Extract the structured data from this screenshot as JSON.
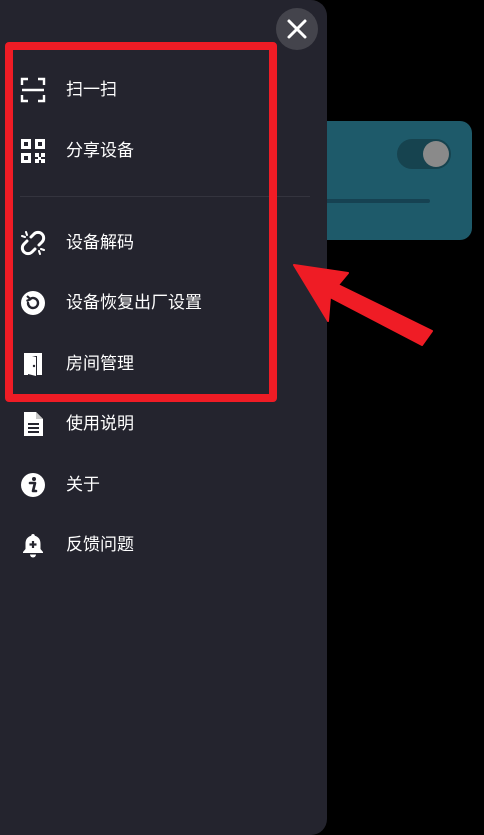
{
  "close_button": {
    "icon": "close-icon"
  },
  "menu": {
    "items": [
      {
        "id": "scan",
        "label": "扫一扫",
        "icon": "scan-frame-icon"
      },
      {
        "id": "share",
        "label": "分享设备",
        "icon": "qr-code-icon"
      },
      {
        "id": "unbind",
        "label": "设备解码",
        "icon": "broken-link-icon"
      },
      {
        "id": "reset",
        "label": "设备恢复出厂设置",
        "icon": "reset-circle-icon"
      },
      {
        "id": "rooms",
        "label": "房间管理",
        "icon": "door-icon"
      },
      {
        "id": "manual",
        "label": "使用说明",
        "icon": "document-icon"
      },
      {
        "id": "about",
        "label": "关于",
        "icon": "info-icon"
      },
      {
        "id": "feedback",
        "label": "反馈问题",
        "icon": "bell-plus-icon"
      }
    ]
  },
  "annotation": {
    "box_color": "#ef1c25",
    "arrow_color": "#ef1c25"
  },
  "colors": {
    "drawer_bg": "#24242e",
    "background_card": "#1e5a6a",
    "page_bg": "#000000",
    "text": "#ffffff"
  }
}
